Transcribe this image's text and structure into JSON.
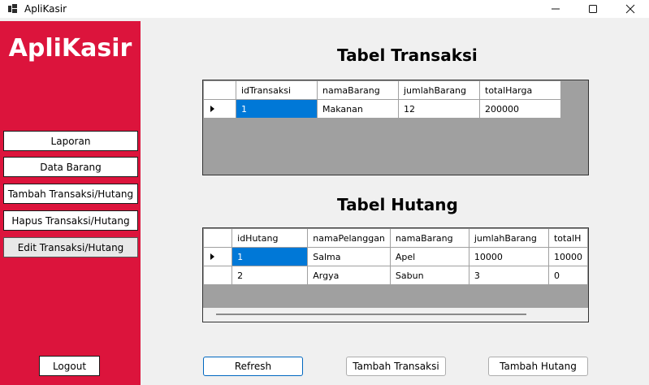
{
  "window": {
    "title": "ApliKasir"
  },
  "sidebar": {
    "brand": "ApliKasir",
    "items": [
      {
        "label": "Laporan"
      },
      {
        "label": "Data Barang"
      },
      {
        "label": "Tambah Transaksi/Hutang"
      },
      {
        "label": "Hapus Transaksi/Hutang"
      },
      {
        "label": "Edit Transaksi/Hutang"
      }
    ],
    "logout": "Logout"
  },
  "transaksi": {
    "title": "Tabel Transaksi",
    "columns": [
      "idTransaksi",
      "namaBarang",
      "jumlahBarang",
      "totalHarga"
    ],
    "rows": [
      [
        "1",
        "Makanan",
        "12",
        "200000"
      ]
    ]
  },
  "hutang": {
    "title": "Tabel Hutang",
    "columns": [
      "idHutang",
      "namaPelanggan",
      "namaBarang",
      "jumlahBarang",
      "totalH"
    ],
    "rows": [
      [
        "1",
        "Salma",
        "Apel",
        "10000",
        "10000"
      ],
      [
        "2",
        "Argya",
        "Sabun",
        "3",
        "0"
      ]
    ]
  },
  "actions": {
    "refresh": "Refresh",
    "tambah_transaksi": "Tambah Transaksi",
    "tambah_hutang": "Tambah Hutang"
  },
  "colors": {
    "sidebar": "#dc143c",
    "selection": "#0078d7",
    "grid_background": "#a0a0a0"
  }
}
